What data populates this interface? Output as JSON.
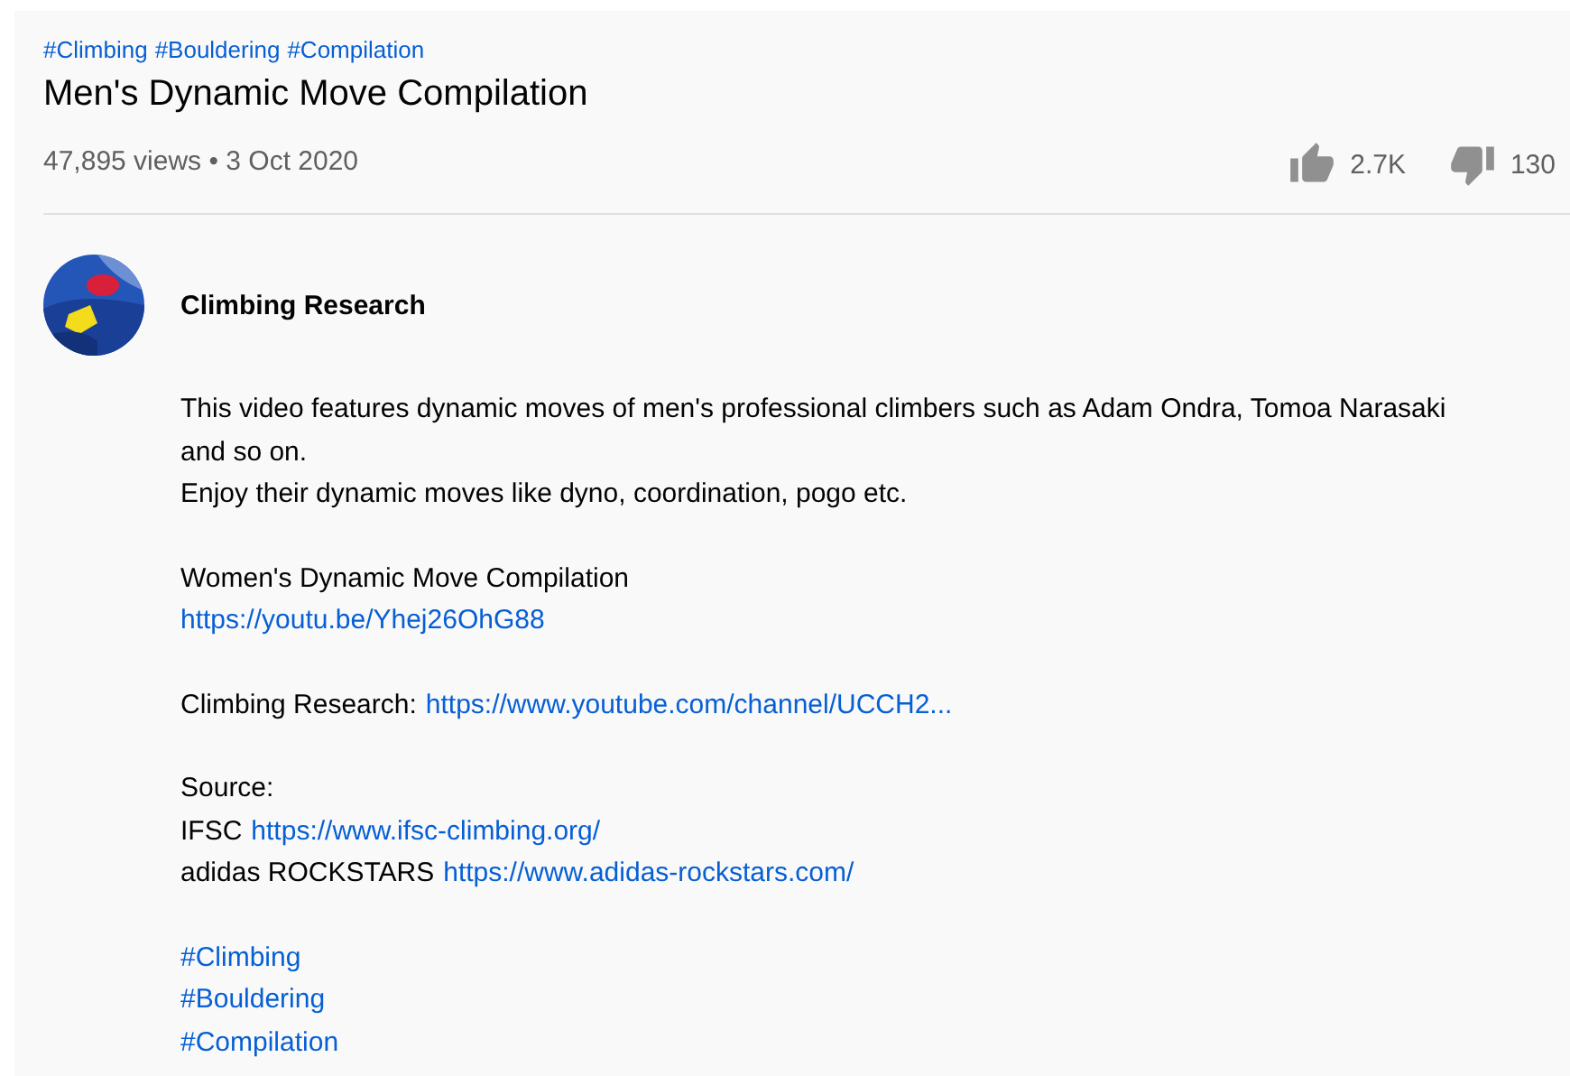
{
  "hashtags": [
    "#Climbing",
    "#Bouldering",
    "#Compilation"
  ],
  "title": "Men's Dynamic Move Compilation",
  "meta": "47,895 views • 3 Oct 2020",
  "likes": "2.7K",
  "dislikes": "130",
  "channel": {
    "name": "Climbing Research"
  },
  "description": [
    [
      [
        {
          "kind": "text",
          "text": "This video features dynamic moves of men's professional climbers such as Adam Ondra, Tomoa Narasaki and so on."
        }
      ],
      [
        {
          "kind": "text",
          "text": "Enjoy their dynamic moves like dyno, coordination, pogo etc."
        }
      ]
    ],
    [
      [
        {
          "kind": "text",
          "text": "Women's Dynamic Move Compilation"
        }
      ],
      [
        {
          "kind": "link",
          "text": "https://youtu.be/Yhej26OhG88"
        }
      ]
    ],
    [
      [
        {
          "kind": "text",
          "text": "Climbing Research:"
        },
        {
          "kind": "link",
          "text": "https://www.youtube.com/channel/UCCH2..."
        }
      ]
    ],
    [
      [
        {
          "kind": "text",
          "text": "Source:"
        }
      ],
      [
        {
          "kind": "text",
          "text": "IFSC"
        },
        {
          "kind": "link",
          "text": "https://www.ifsc-climbing.org/"
        }
      ],
      [
        {
          "kind": "text",
          "text": "adidas ROCKSTARS"
        },
        {
          "kind": "link",
          "text": "https://www.adidas-rockstars.com/"
        }
      ]
    ],
    [
      [
        {
          "kind": "link",
          "text": "#Climbing"
        }
      ],
      [
        {
          "kind": "link",
          "text": "#Bouldering"
        }
      ],
      [
        {
          "kind": "link",
          "text": "#Compilation"
        }
      ]
    ]
  ]
}
